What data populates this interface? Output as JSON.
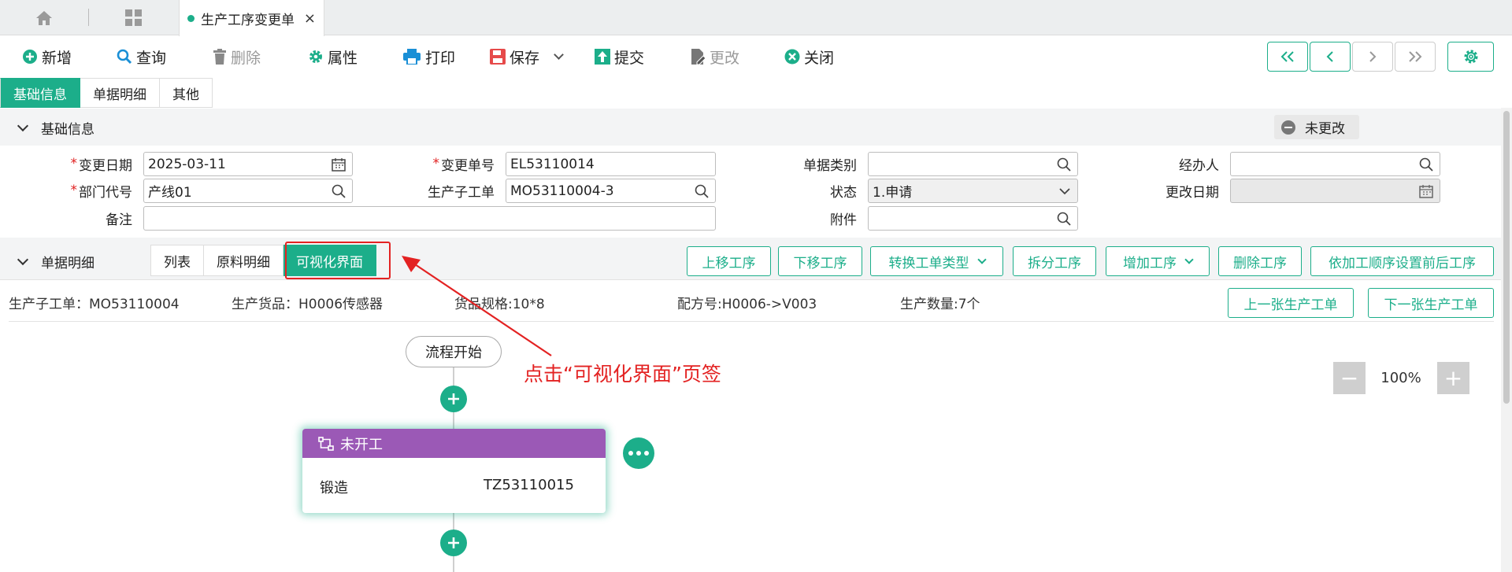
{
  "tabs": {
    "doc_tab_title": "生产工序变更单",
    "close_glyph": "×"
  },
  "toolbar": {
    "new": "新增",
    "query": "查询",
    "delete": "删除",
    "properties": "属性",
    "print": "打印",
    "save": "保存",
    "submit": "提交",
    "modify": "更改",
    "close": "关闭"
  },
  "section_tabs": [
    "基础信息",
    "单据明细",
    "其他"
  ],
  "basic_info": {
    "title": "基础信息",
    "status_badge": "未更改",
    "fields": {
      "change_date": {
        "label": "变更日期",
        "value": "2025-03-11",
        "required": "*"
      },
      "change_no": {
        "label": "变更单号",
        "value": "EL53110014",
        "required": "*"
      },
      "doc_type": {
        "label": "单据类别",
        "value": ""
      },
      "handler": {
        "label": "经办人",
        "value": ""
      },
      "dept_code": {
        "label": "部门代号",
        "value": "产线01",
        "required": "*"
      },
      "sub_order": {
        "label": "生产子工单",
        "value": "MO53110004-3"
      },
      "state": {
        "label": "状态",
        "value": "1.申请"
      },
      "modify_date": {
        "label": "更改日期",
        "value": ""
      },
      "remark": {
        "label": "备注",
        "value": ""
      },
      "attachment": {
        "label": "附件",
        "value": ""
      }
    }
  },
  "detail": {
    "title": "单据明细",
    "sub_tabs": [
      "列表",
      "原料明细",
      "可视化界面"
    ],
    "actions": {
      "move_up": "上移工序",
      "move_down": "下移工序",
      "convert_type": "转换工单类型",
      "split": "拆分工序",
      "add": "增加工序",
      "delete": "删除工序",
      "set_order": "依加工顺序设置前后工序",
      "prev_order": "上一张生产工单",
      "next_order": "下一张生产工单"
    },
    "info": {
      "sub_order": "生产子工单：MO53110004",
      "goods": "生产货品：H0006传感器",
      "spec": "货品规格:10*8",
      "recipe": "配方号:H0006->V003",
      "qty": "生产数量:7个"
    }
  },
  "flow": {
    "start": "流程开始",
    "card_status": "未开工",
    "card_process": "锻造",
    "card_code": "TZ53110015",
    "zoom": "100%",
    "zoom_minus": "−",
    "zoom_plus": "+"
  },
  "annotation": "点击“可视化界面”页签",
  "colors": {
    "accent": "#1cae8a",
    "card_header": "#9b59b6",
    "highlight": "#e32222"
  }
}
